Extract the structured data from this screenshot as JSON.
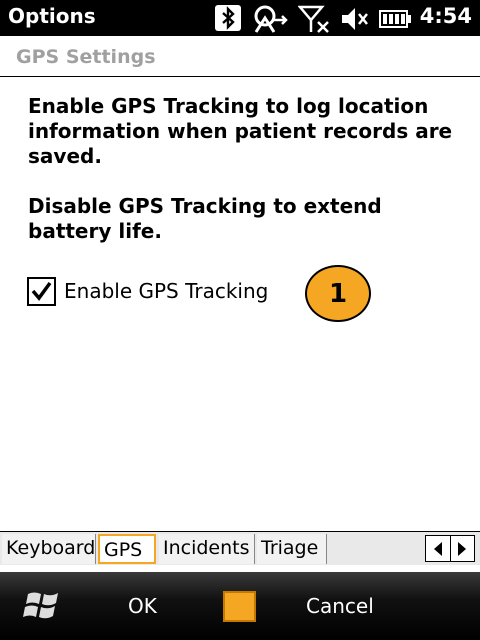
{
  "titlebar": {
    "app_title": "Options",
    "clock": "4:54",
    "icons": [
      "bluetooth-icon",
      "data-connection-icon",
      "no-signal-icon",
      "speaker-muted-icon",
      "battery-icon"
    ]
  },
  "page": {
    "title": "GPS Settings",
    "paragraph1": "Enable GPS Tracking to log location\ninformation when patient records are\nsaved.",
    "paragraph2": "Disable GPS Tracking to extend\nbattery life.",
    "checkbox": {
      "label": "Enable GPS Tracking",
      "checked": true
    },
    "callout": "1"
  },
  "tabs": [
    {
      "label": "Keyboard",
      "active": false
    },
    {
      "label": "GPS",
      "active": true
    },
    {
      "label": "Incidents",
      "active": false
    },
    {
      "label": "Triage",
      "active": false
    }
  ],
  "softkeys": {
    "left": "OK",
    "right": "Cancel"
  },
  "colors": {
    "accent": "#f5a623",
    "title_gray": "#a0a0a0"
  }
}
